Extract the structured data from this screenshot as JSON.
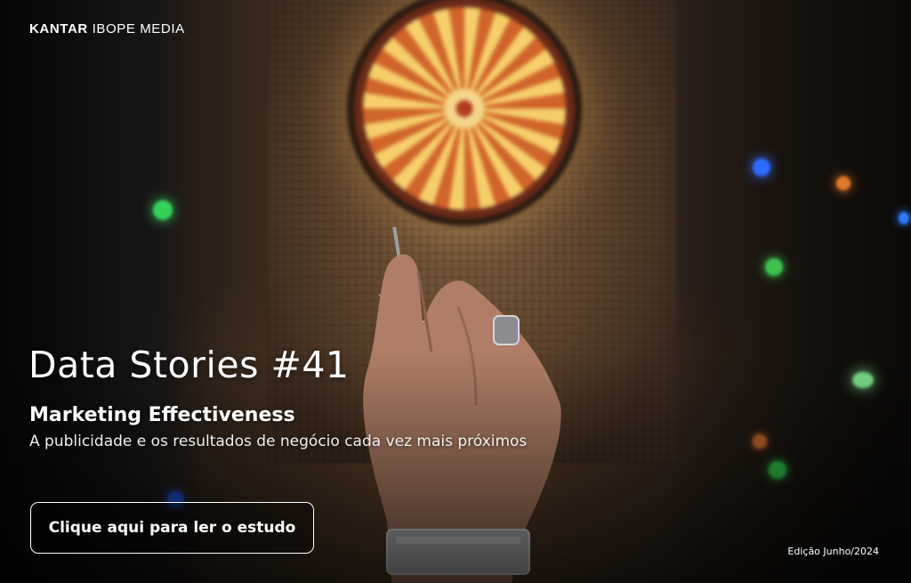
{
  "brand": {
    "primary": "KANTAR",
    "secondary": "IBOPE MEDIA"
  },
  "hero": {
    "title": "Data Stories #41",
    "subtitle": "Marketing Effectiveness",
    "tagline": "A publicidade e os resultados de negócio cada vez mais próximos",
    "cta_label": "Clique aqui para ler o estudo",
    "edition": "Edição Junho/2024"
  },
  "background": {
    "description_icons": [
      "dartboard-icon",
      "hand-with-dart-icon"
    ],
    "accent_colors": [
      "#f6cf6a",
      "#d0642a",
      "#2fd35a",
      "#2f6bff"
    ]
  }
}
